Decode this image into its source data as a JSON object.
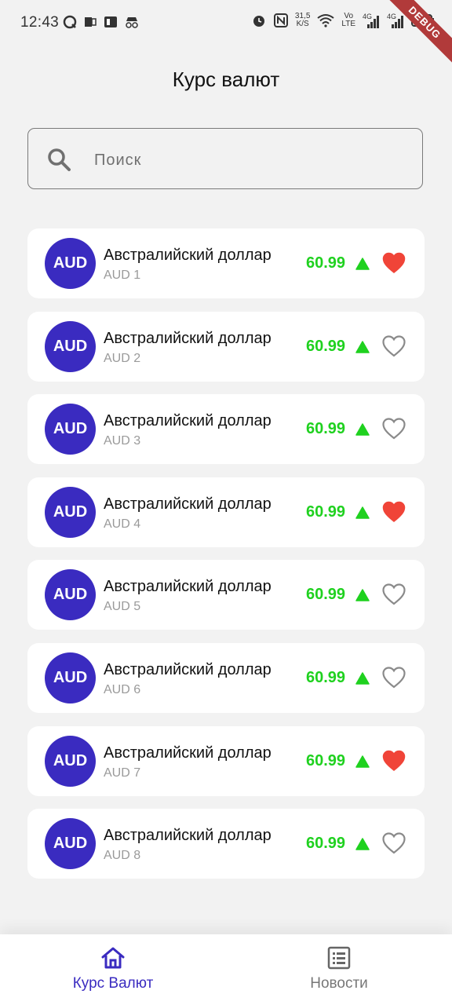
{
  "status_bar": {
    "time": "12:43",
    "speed": "31,5",
    "speed_unit": "K/S",
    "net1": "Vo",
    "net2": "LTE",
    "net3": "4G",
    "net4": "4G",
    "debug_label": "DEBUG"
  },
  "title": "Курс валют",
  "search": {
    "placeholder": "Поиск"
  },
  "currencies": [
    {
      "badge": "AUD",
      "name": "Австралийский доллар",
      "code": "AUD 1",
      "rate": "60.99",
      "favorite": true
    },
    {
      "badge": "AUD",
      "name": "Австралийский доллар",
      "code": "AUD 2",
      "rate": "60.99",
      "favorite": false
    },
    {
      "badge": "AUD",
      "name": "Австралийский доллар",
      "code": "AUD 3",
      "rate": "60.99",
      "favorite": false
    },
    {
      "badge": "AUD",
      "name": "Австралийский доллар",
      "code": "AUD 4",
      "rate": "60.99",
      "favorite": true
    },
    {
      "badge": "AUD",
      "name": "Австралийский доллар",
      "code": "AUD 5",
      "rate": "60.99",
      "favorite": false
    },
    {
      "badge": "AUD",
      "name": "Австралийский доллар",
      "code": "AUD 6",
      "rate": "60.99",
      "favorite": false
    },
    {
      "badge": "AUD",
      "name": "Австралийский доллар",
      "code": "AUD 7",
      "rate": "60.99",
      "favorite": true
    },
    {
      "badge": "AUD",
      "name": "Австралийский доллар",
      "code": "AUD 8",
      "rate": "60.99",
      "favorite": false
    }
  ],
  "bottom_nav": {
    "items": [
      {
        "label": "Курс Валют",
        "icon": "home-icon",
        "active": true
      },
      {
        "label": "Новости",
        "icon": "news-list-icon",
        "active": false
      }
    ]
  },
  "colors": {
    "accent": "#3a2bc0",
    "rate_up": "#1fd11f",
    "favorite": "#f04438",
    "background": "#f2f2f2"
  }
}
